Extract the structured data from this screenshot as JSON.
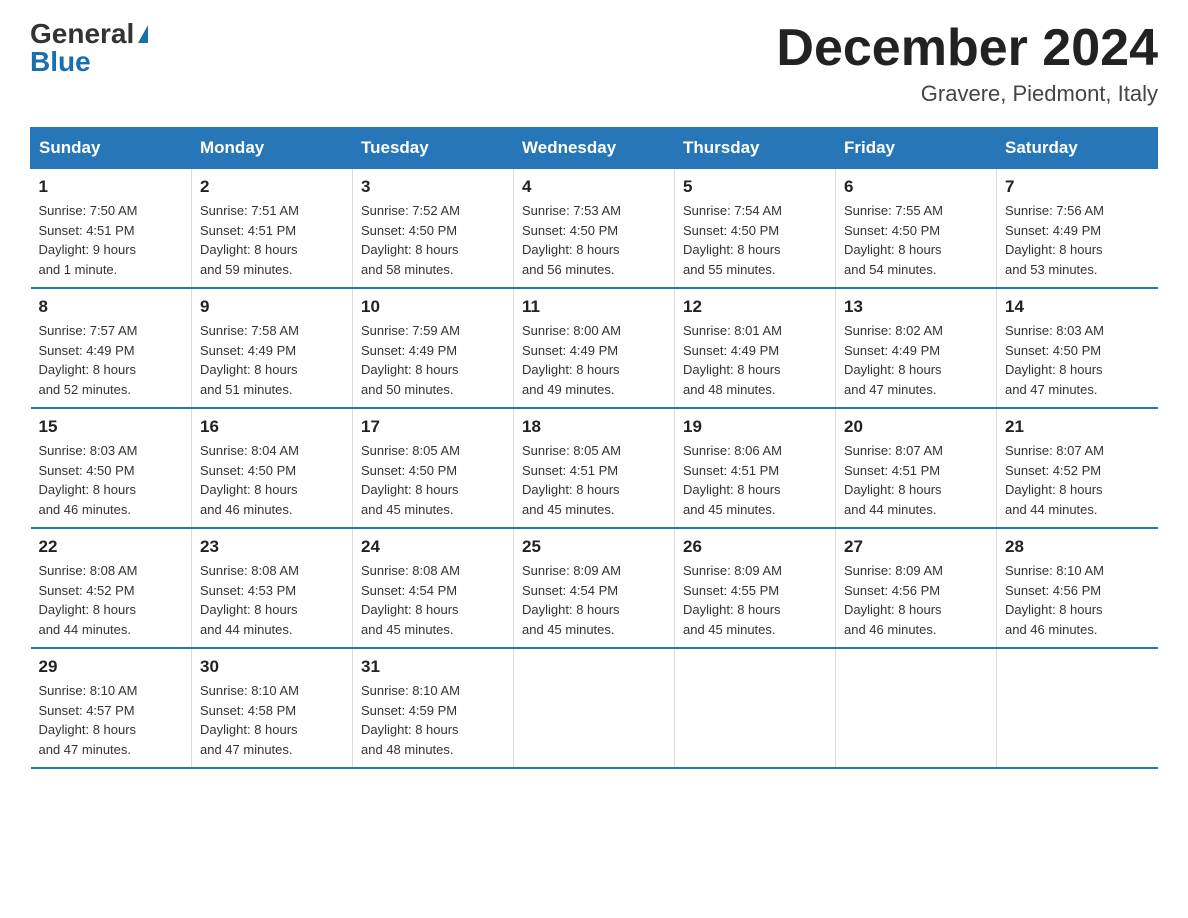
{
  "header": {
    "logo_general": "General",
    "logo_blue": "Blue",
    "month_title": "December 2024",
    "location": "Gravere, Piedmont, Italy"
  },
  "days_of_week": [
    "Sunday",
    "Monday",
    "Tuesday",
    "Wednesday",
    "Thursday",
    "Friday",
    "Saturday"
  ],
  "weeks": [
    [
      {
        "day": "1",
        "info": "Sunrise: 7:50 AM\nSunset: 4:51 PM\nDaylight: 9 hours\nand 1 minute."
      },
      {
        "day": "2",
        "info": "Sunrise: 7:51 AM\nSunset: 4:51 PM\nDaylight: 8 hours\nand 59 minutes."
      },
      {
        "day": "3",
        "info": "Sunrise: 7:52 AM\nSunset: 4:50 PM\nDaylight: 8 hours\nand 58 minutes."
      },
      {
        "day": "4",
        "info": "Sunrise: 7:53 AM\nSunset: 4:50 PM\nDaylight: 8 hours\nand 56 minutes."
      },
      {
        "day": "5",
        "info": "Sunrise: 7:54 AM\nSunset: 4:50 PM\nDaylight: 8 hours\nand 55 minutes."
      },
      {
        "day": "6",
        "info": "Sunrise: 7:55 AM\nSunset: 4:50 PM\nDaylight: 8 hours\nand 54 minutes."
      },
      {
        "day": "7",
        "info": "Sunrise: 7:56 AM\nSunset: 4:49 PM\nDaylight: 8 hours\nand 53 minutes."
      }
    ],
    [
      {
        "day": "8",
        "info": "Sunrise: 7:57 AM\nSunset: 4:49 PM\nDaylight: 8 hours\nand 52 minutes."
      },
      {
        "day": "9",
        "info": "Sunrise: 7:58 AM\nSunset: 4:49 PM\nDaylight: 8 hours\nand 51 minutes."
      },
      {
        "day": "10",
        "info": "Sunrise: 7:59 AM\nSunset: 4:49 PM\nDaylight: 8 hours\nand 50 minutes."
      },
      {
        "day": "11",
        "info": "Sunrise: 8:00 AM\nSunset: 4:49 PM\nDaylight: 8 hours\nand 49 minutes."
      },
      {
        "day": "12",
        "info": "Sunrise: 8:01 AM\nSunset: 4:49 PM\nDaylight: 8 hours\nand 48 minutes."
      },
      {
        "day": "13",
        "info": "Sunrise: 8:02 AM\nSunset: 4:49 PM\nDaylight: 8 hours\nand 47 minutes."
      },
      {
        "day": "14",
        "info": "Sunrise: 8:03 AM\nSunset: 4:50 PM\nDaylight: 8 hours\nand 47 minutes."
      }
    ],
    [
      {
        "day": "15",
        "info": "Sunrise: 8:03 AM\nSunset: 4:50 PM\nDaylight: 8 hours\nand 46 minutes."
      },
      {
        "day": "16",
        "info": "Sunrise: 8:04 AM\nSunset: 4:50 PM\nDaylight: 8 hours\nand 46 minutes."
      },
      {
        "day": "17",
        "info": "Sunrise: 8:05 AM\nSunset: 4:50 PM\nDaylight: 8 hours\nand 45 minutes."
      },
      {
        "day": "18",
        "info": "Sunrise: 8:05 AM\nSunset: 4:51 PM\nDaylight: 8 hours\nand 45 minutes."
      },
      {
        "day": "19",
        "info": "Sunrise: 8:06 AM\nSunset: 4:51 PM\nDaylight: 8 hours\nand 45 minutes."
      },
      {
        "day": "20",
        "info": "Sunrise: 8:07 AM\nSunset: 4:51 PM\nDaylight: 8 hours\nand 44 minutes."
      },
      {
        "day": "21",
        "info": "Sunrise: 8:07 AM\nSunset: 4:52 PM\nDaylight: 8 hours\nand 44 minutes."
      }
    ],
    [
      {
        "day": "22",
        "info": "Sunrise: 8:08 AM\nSunset: 4:52 PM\nDaylight: 8 hours\nand 44 minutes."
      },
      {
        "day": "23",
        "info": "Sunrise: 8:08 AM\nSunset: 4:53 PM\nDaylight: 8 hours\nand 44 minutes."
      },
      {
        "day": "24",
        "info": "Sunrise: 8:08 AM\nSunset: 4:54 PM\nDaylight: 8 hours\nand 45 minutes."
      },
      {
        "day": "25",
        "info": "Sunrise: 8:09 AM\nSunset: 4:54 PM\nDaylight: 8 hours\nand 45 minutes."
      },
      {
        "day": "26",
        "info": "Sunrise: 8:09 AM\nSunset: 4:55 PM\nDaylight: 8 hours\nand 45 minutes."
      },
      {
        "day": "27",
        "info": "Sunrise: 8:09 AM\nSunset: 4:56 PM\nDaylight: 8 hours\nand 46 minutes."
      },
      {
        "day": "28",
        "info": "Sunrise: 8:10 AM\nSunset: 4:56 PM\nDaylight: 8 hours\nand 46 minutes."
      }
    ],
    [
      {
        "day": "29",
        "info": "Sunrise: 8:10 AM\nSunset: 4:57 PM\nDaylight: 8 hours\nand 47 minutes."
      },
      {
        "day": "30",
        "info": "Sunrise: 8:10 AM\nSunset: 4:58 PM\nDaylight: 8 hours\nand 47 minutes."
      },
      {
        "day": "31",
        "info": "Sunrise: 8:10 AM\nSunset: 4:59 PM\nDaylight: 8 hours\nand 48 minutes."
      },
      {
        "day": "",
        "info": ""
      },
      {
        "day": "",
        "info": ""
      },
      {
        "day": "",
        "info": ""
      },
      {
        "day": "",
        "info": ""
      }
    ]
  ]
}
